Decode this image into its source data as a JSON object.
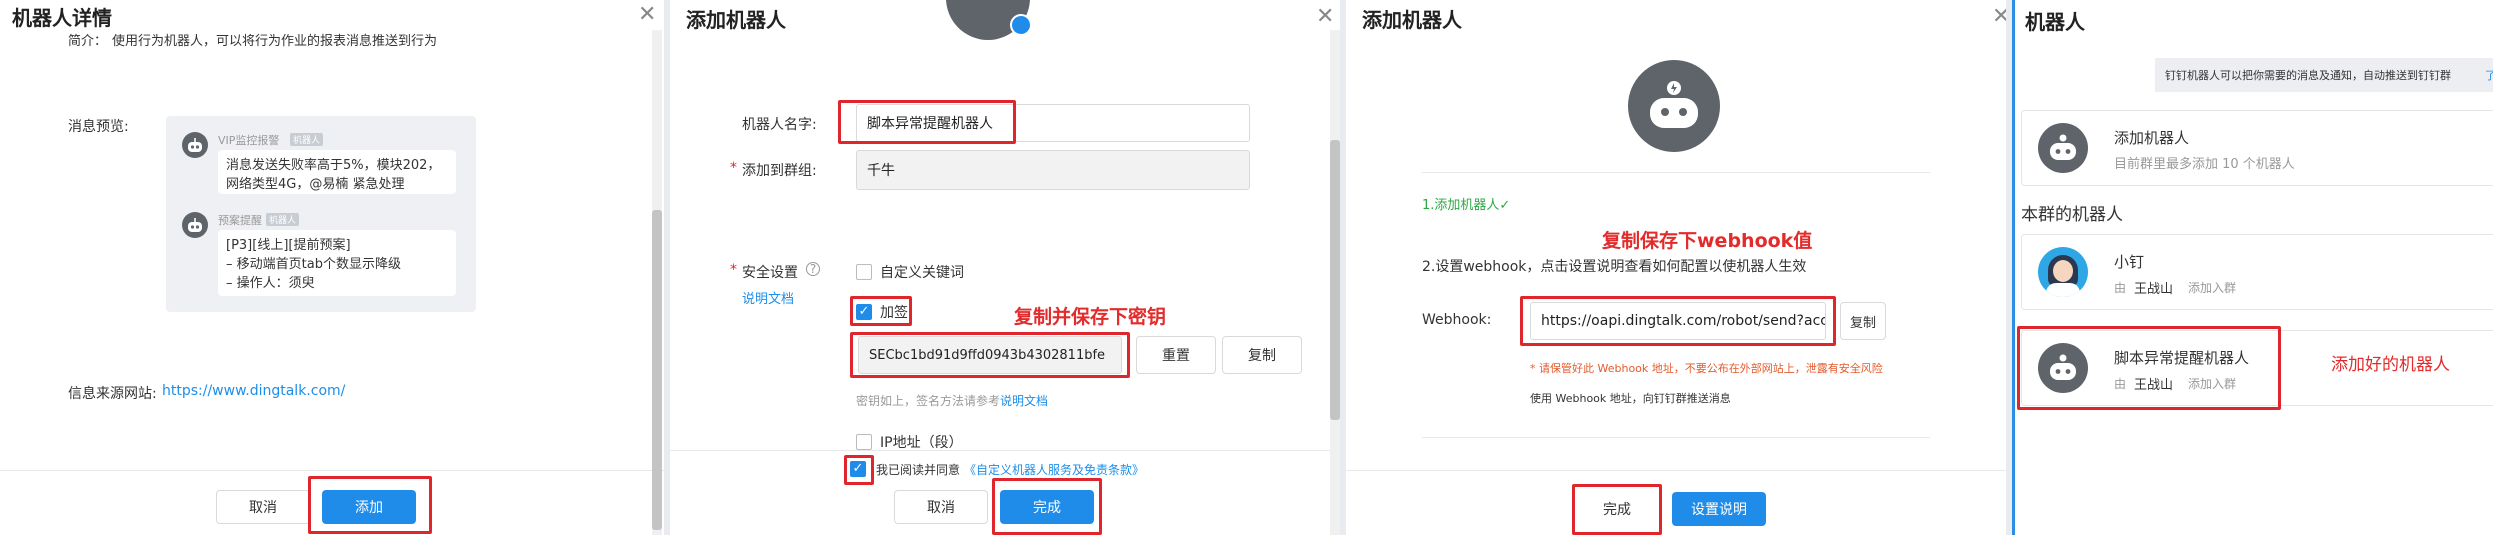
{
  "panel1": {
    "title": "机器人详情",
    "top_clip_label": "简介：",
    "top_clip_text": "使用行为机器人，可以将行为作业的报表消息推送到行为",
    "preview_label": "消息预览:",
    "msg1_sender": "VIP监控报警",
    "msg1_badge": "机器人",
    "msg1_line1": "消息发送失败率高于5%，模块202，",
    "msg1_line2": "网络类型4G，@易楠 紧急处理",
    "msg2_sender": "预案提醒",
    "msg2_badge": "机器人",
    "msg2_line1": "[P3][线上][提前预案]",
    "msg2_line2": "– 移动端首页tab个数显示降级",
    "msg2_line3": "– 操作人：须臾",
    "source_label": "信息来源网站:",
    "source_link": "https://www.dingtalk.com/",
    "cancel": "取消",
    "add": "添加"
  },
  "panel2": {
    "title": "添加机器人",
    "name_label": "机器人名字:",
    "name_value": "脚本异常提醒机器人",
    "group_label": "添加到群组:",
    "group_value": "千牛",
    "security_label": "安全设置",
    "help_doc": "说明文档",
    "opt_keyword": "自定义关键词",
    "opt_sign": "加签",
    "secret_value": "SECbc1bd91d9ffd0943b4302811bfe",
    "reset": "重置",
    "copy": "复制",
    "secret_hint": "密钥如上，签名方法请参考",
    "secret_hint_link": "说明文档",
    "opt_ip": "IP地址（段）",
    "agree_prefix": "我已阅读并同意",
    "agree_link": "《自定义机器人服务及免责条款》",
    "cancel": "取消",
    "done": "完成",
    "annotation": "复制并保存下密钥"
  },
  "panel3": {
    "title": "添加机器人",
    "step1": "1.添加机器人✓",
    "step2": "2.设置webhook，点击设置说明查看如何配置以使机器人生效",
    "webhook_label": "Webhook:",
    "webhook_value": "https://oapi.dingtalk.com/robot/send?access_t",
    "copy": "复制",
    "warning": "* 请保管好此 Webhook 地址，不要公布在外部网站上，泄露有安全风险",
    "usage": "使用 Webhook 地址，向钉钉群推送消息",
    "done": "完成",
    "settings_help": "设置说明",
    "annotation": "复制保存下webhook值"
  },
  "panel4": {
    "title": "机器人",
    "banner": "钉钉机器人可以把你需要的消息及通知，自动推送到钉钉群",
    "banner_link": "了",
    "add_title": "添加机器人",
    "add_sub": "目前群里最多添加 10 个机器人",
    "section": "本群的机器人",
    "bot1_name": "小钉",
    "bot1_by": "由",
    "bot1_owner": "王战山",
    "bot1_action": "添加入群",
    "bot2_name": "脚本异常提醒机器人",
    "bot2_by": "由",
    "bot2_owner": "王战山",
    "bot2_action": "添加入群",
    "annotation": "添加好的机器人"
  },
  "colors": {
    "primary": "#1f8cea",
    "annotation_red": "#e0262d",
    "robot_gray": "#5e6469",
    "success_green": "#2aa845"
  }
}
